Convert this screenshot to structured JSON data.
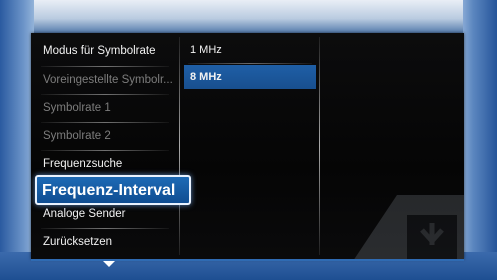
{
  "menu": {
    "items": [
      {
        "label": "Modus für Symbolrate",
        "state": "normal"
      },
      {
        "label": "Voreingestellte Symbolr...",
        "state": "disabled"
      },
      {
        "label": "Symbolrate 1",
        "state": "disabled"
      },
      {
        "label": "Symbolrate 2",
        "state": "disabled"
      },
      {
        "label": "Frequenzsuche",
        "state": "normal"
      },
      {
        "label": "Frequenz-Interval",
        "state": "selected"
      },
      {
        "label": "Analoge Sender",
        "state": "normal"
      },
      {
        "label": "Zurücksetzen",
        "state": "normal"
      }
    ]
  },
  "options": {
    "items": [
      {
        "label": "1 MHz",
        "highlighted": false
      },
      {
        "label": "8 MHz",
        "highlighted": true
      }
    ]
  },
  "colors": {
    "selection_blue": "#1d6ab5",
    "highlight_blue": "#1f5fa6",
    "disabled_text": "#7d7d7d",
    "frame_blue": "#2a5aa0"
  },
  "icons": {
    "scroll_down": "chevron-down-icon",
    "watermark": "tv-logo-watermark-icon"
  }
}
